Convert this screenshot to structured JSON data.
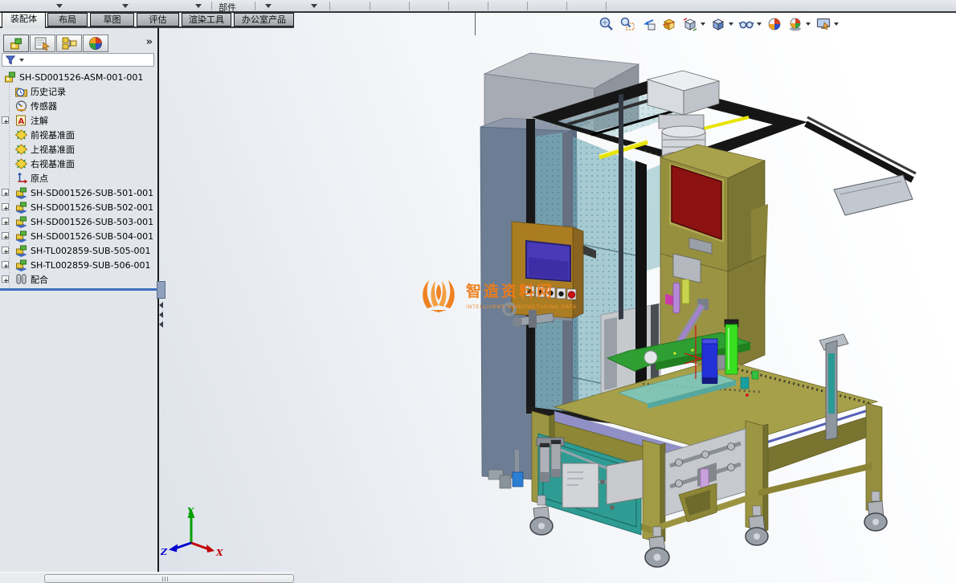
{
  "command_bar": {
    "part_label": "部件"
  },
  "tabs": [
    {
      "label": "装配体",
      "active": true
    },
    {
      "label": "布局",
      "active": false
    },
    {
      "label": "草图",
      "active": false
    },
    {
      "label": "评估",
      "active": false
    },
    {
      "label": "渲染工具",
      "active": false
    },
    {
      "label": "办公室产品",
      "active": false
    }
  ],
  "heads_up_toolbar": {
    "icons": [
      "zoom-to-fit",
      "zoom-to-area",
      "previous-view",
      "section-view",
      "view-orientation",
      "display-style",
      "hide-show-items",
      "edit-appearance",
      "apply-scene",
      "view-settings"
    ]
  },
  "panel": {
    "tabs": [
      "feature-manager",
      "property-manager",
      "configuration-manager",
      "display-manager"
    ],
    "overflow_label": "»",
    "filter": {
      "icon": "filter-funnel"
    },
    "tree": {
      "items": [
        {
          "label": "SH-SD001526-ASM-001-001",
          "icon": "assembly"
        },
        {
          "label": "历史记录",
          "icon": "history-folder"
        },
        {
          "label": "传感器",
          "icon": "sensors"
        },
        {
          "label": "注解",
          "icon": "annotations",
          "expandable": true
        },
        {
          "label": "前视基准面",
          "icon": "plane"
        },
        {
          "label": "上视基准面",
          "icon": "plane"
        },
        {
          "label": "右视基准面",
          "icon": "plane"
        },
        {
          "label": "原点",
          "icon": "origin"
        },
        {
          "label": "SH-SD001526-SUB-501-001",
          "icon": "subassembly",
          "expandable": true
        },
        {
          "label": "SH-SD001526-SUB-502-001",
          "icon": "subassembly",
          "expandable": true
        },
        {
          "label": "SH-SD001526-SUB-503-001",
          "icon": "subassembly",
          "expandable": true
        },
        {
          "label": "SH-SD001526-SUB-504-001",
          "icon": "subassembly",
          "expandable": true
        },
        {
          "label": "SH-TL002859-SUB-505-001",
          "icon": "subassembly",
          "expandable": true
        },
        {
          "label": "SH-TL002859-SUB-506-001",
          "icon": "subassembly",
          "expandable": true
        },
        {
          "label": "配合",
          "icon": "mates",
          "expandable": true
        }
      ]
    }
  },
  "viewport": {
    "watermark": {
      "title": "智造资料网",
      "subtitle": "INTELLIGENT MANUFACTURING DATA",
      "color": "#ef7c16"
    },
    "triad": {
      "x": "X",
      "y": "Y",
      "z": "Z",
      "x_color": "#c00000",
      "y_color": "#009900",
      "z_color": "#0000cc"
    }
  },
  "colors": {
    "frame_black": "#161616",
    "machine_olive": "#968f3e",
    "panel_red": "#8c1212",
    "mesh_teal": "#7cb4bd",
    "table_olive": "#a6a04b",
    "watermark_orange": "#ef7c16"
  }
}
